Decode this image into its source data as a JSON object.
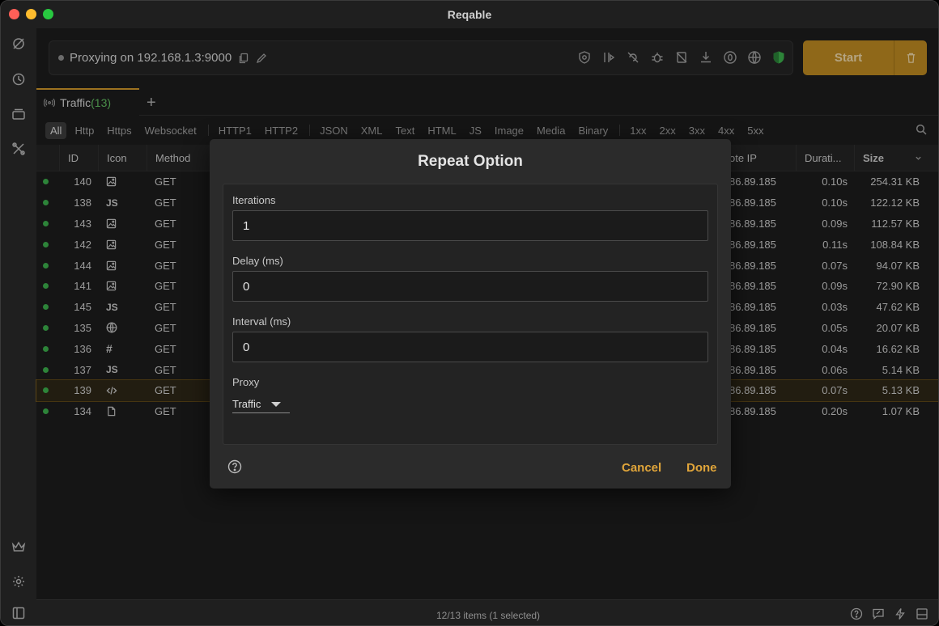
{
  "app": {
    "title": "Reqable",
    "colors": {
      "accent": "#c8922a",
      "start_button": "#b88620",
      "success_dot": "#3aa94a",
      "shield": "#3aa94a"
    }
  },
  "sidebar": {
    "icons": [
      "capture-icon",
      "history-icon",
      "collections-icon",
      "tools-icon",
      "crown-icon",
      "settings-icon",
      "sidebar-toggle-icon"
    ]
  },
  "proxy": {
    "status_text": "Proxying on 192.168.1.3:9000",
    "toolbar_icons": [
      "ssl-shield-icon",
      "breakpoint-icon",
      "no-capture-icon",
      "debug-icon",
      "copy-script-icon",
      "download-icon",
      "zero-icon",
      "globe-icon",
      "verified-shield-icon"
    ]
  },
  "controls": {
    "start_label": "Start"
  },
  "tabs": [
    {
      "label": "Traffic",
      "count": "(13)"
    }
  ],
  "filters": [
    [
      "All",
      "Http",
      "Https",
      "Websocket"
    ],
    [
      "HTTP1",
      "HTTP2"
    ],
    [
      "JSON",
      "XML",
      "Text",
      "HTML",
      "JS",
      "Image",
      "Media",
      "Binary"
    ],
    [
      "1xx",
      "2xx",
      "3xx",
      "4xx",
      "5xx"
    ]
  ],
  "table": {
    "headers": {
      "id": "ID",
      "icon": "Icon",
      "method": "Method",
      "remote_ip": "ote IP",
      "duration": "Durati...",
      "size": "Size"
    },
    "rows": [
      {
        "id": "140",
        "icon": "image",
        "method": "GET",
        "ip": "86.89.185",
        "duration": "0.10s",
        "size": "254.31 KB"
      },
      {
        "id": "138",
        "icon": "js",
        "method": "GET",
        "ip": "86.89.185",
        "duration": "0.10s",
        "size": "122.12 KB"
      },
      {
        "id": "143",
        "icon": "image",
        "method": "GET",
        "ip": "86.89.185",
        "duration": "0.09s",
        "size": "112.57 KB"
      },
      {
        "id": "142",
        "icon": "image",
        "method": "GET",
        "ip": "86.89.185",
        "duration": "0.11s",
        "size": "108.84 KB"
      },
      {
        "id": "144",
        "icon": "image",
        "method": "GET",
        "ip": "86.89.185",
        "duration": "0.07s",
        "size": "94.07 KB"
      },
      {
        "id": "141",
        "icon": "image",
        "method": "GET",
        "ip": "86.89.185",
        "duration": "0.09s",
        "size": "72.90 KB"
      },
      {
        "id": "145",
        "icon": "js",
        "method": "GET",
        "ip": "86.89.185",
        "duration": "0.03s",
        "size": "47.62 KB"
      },
      {
        "id": "135",
        "icon": "globe",
        "method": "GET",
        "ip": "86.89.185",
        "duration": "0.05s",
        "size": "20.07 KB"
      },
      {
        "id": "136",
        "icon": "hash",
        "method": "GET",
        "ip": "86.89.185",
        "duration": "0.04s",
        "size": "16.62 KB"
      },
      {
        "id": "137",
        "icon": "js",
        "method": "GET",
        "ip": "86.89.185",
        "duration": "0.06s",
        "size": "5.14 KB"
      },
      {
        "id": "139",
        "icon": "code",
        "method": "GET",
        "ip": "86.89.185",
        "duration": "0.07s",
        "size": "5.13 KB",
        "selected": true
      },
      {
        "id": "134",
        "icon": "file",
        "method": "GET",
        "ip": "86.89.185",
        "duration": "0.20s",
        "size": "1.07 KB"
      }
    ]
  },
  "dialog": {
    "title": "Repeat Option",
    "iterations_label": "Iterations",
    "iterations_value": "1",
    "delay_label": "Delay (ms)",
    "delay_value": "0",
    "interval_label": "Interval (ms)",
    "interval_value": "0",
    "proxy_label": "Proxy",
    "proxy_value": "Traffic",
    "cancel_label": "Cancel",
    "done_label": "Done"
  },
  "status": {
    "text": "12/13 items (1 selected)",
    "icons": [
      "help-icon",
      "feedback-icon",
      "flash-icon",
      "panel-layout-icon"
    ]
  }
}
